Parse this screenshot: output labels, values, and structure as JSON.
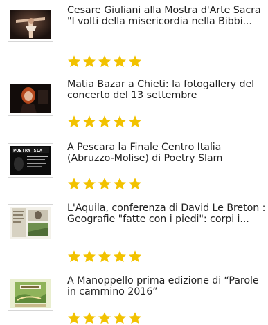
{
  "articles": [
    {
      "title": "Cesare Giuliani alla Mostra d'Arte Sacra \"I volti della misericordia nella Bibbi...",
      "thumbnail_icon": "crucifix-painting-image",
      "rating_stars": 5,
      "star_color": "#f2c200"
    },
    {
      "title": "Matia Bazar a Chieti: la fotogallery del concerto del 13 settembre",
      "thumbnail_icon": "concert-singer-photo",
      "rating_stars": 5,
      "star_color": "#f2c200"
    },
    {
      "title": "A Pescara la Finale Centro Italia (Abruzzo-Molise) di Poetry Slam",
      "thumbnail_icon": "poetry-slam-poster",
      "rating_stars": 5,
      "star_color": "#f2c200"
    },
    {
      "title": "L'Aquila, conferenza di David Le Breton : Geografie \"fatte con i piedi\": corpi i...",
      "thumbnail_icon": "conference-flyer",
      "rating_stars": 5,
      "star_color": "#f2c200"
    },
    {
      "title": "A Manoppello prima edizione di “Parole in cammino 2016”",
      "thumbnail_icon": "walking-event-poster",
      "rating_stars": 5,
      "star_color": "#f2c200"
    }
  ]
}
